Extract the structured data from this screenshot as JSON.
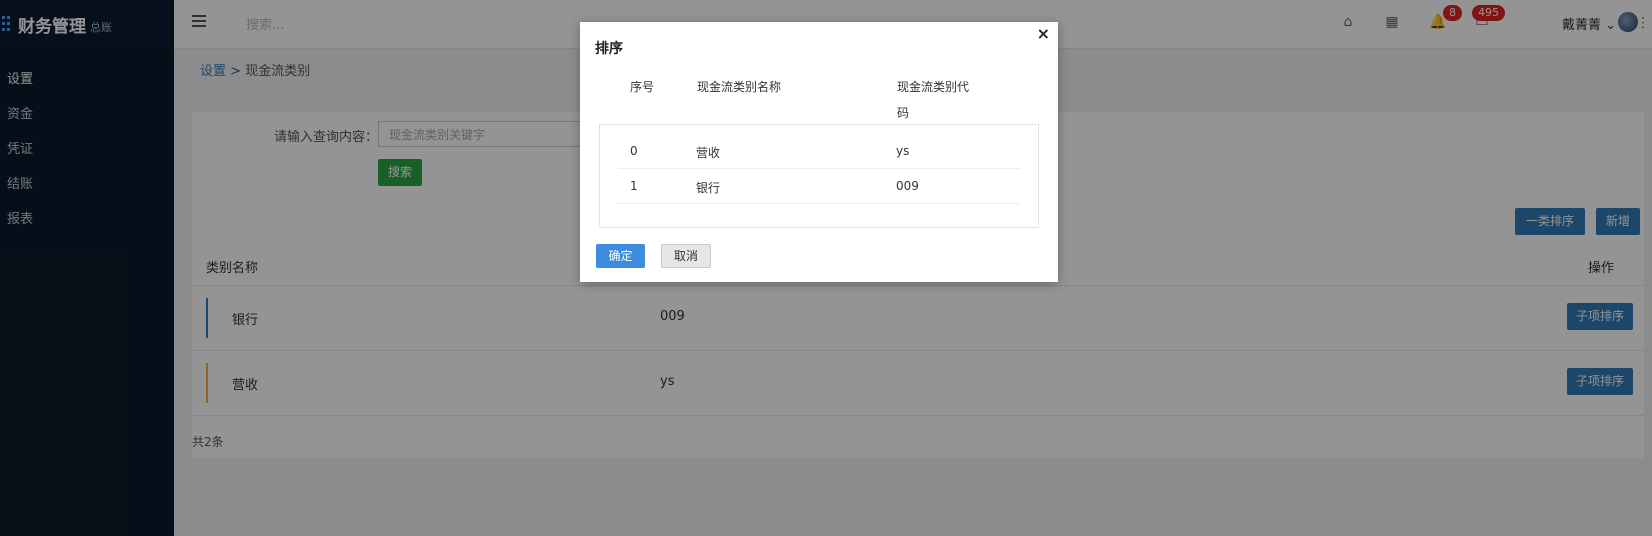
{
  "app": {
    "title": "财务管理",
    "subtitle": "总账"
  },
  "sidebar": {
    "items": [
      {
        "label": "设置"
      },
      {
        "label": "资金"
      },
      {
        "label": "凭证"
      },
      {
        "label": "结账"
      },
      {
        "label": "报表"
      }
    ]
  },
  "header": {
    "search_placeholder": "搜索...",
    "notifications_count": "8",
    "messages_count": "495",
    "username": "戴菁菁"
  },
  "breadcrumb": {
    "root": "设置",
    "separator": ">",
    "current": "现金流类别"
  },
  "filter": {
    "label": "请输入查询内容：",
    "placeholder": "现金流类别关键字",
    "search_button": "搜索"
  },
  "toolbar": {
    "sort_button": "一类排序",
    "add_button": "新增"
  },
  "table": {
    "col_name": "类别名称",
    "col_action": "操作",
    "rows": [
      {
        "name": "银行",
        "code": "009",
        "action": "子项排序"
      },
      {
        "name": "营收",
        "code": "ys",
        "action": "子项排序"
      }
    ],
    "total": "共2条"
  },
  "modal": {
    "title": "排序",
    "close": "×",
    "headers": {
      "index": "序号",
      "name": "现金流类别名称",
      "code_line1": "现金流类别代",
      "code_line2": "码"
    },
    "rows": [
      {
        "index": "0",
        "name": "营收",
        "code": "ys"
      },
      {
        "index": "1",
        "name": "银行",
        "code": "009"
      }
    ],
    "ok": "确定",
    "cancel": "取消"
  },
  "colors": {
    "bank_bar": "#337ab7",
    "revenue_bar": "#f0ad4e",
    "sidebar_bg": "#0c1a2b",
    "primary": "#337ab7",
    "success": "#28a745"
  }
}
